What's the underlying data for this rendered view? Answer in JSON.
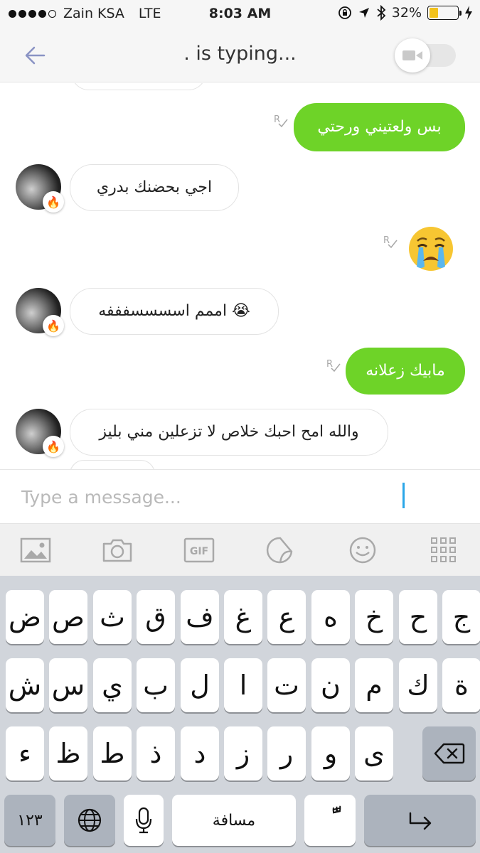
{
  "status_bar": {
    "carrier": "Zain KSA",
    "network": "LTE",
    "time": "8:03 AM",
    "battery": "32%",
    "battery_level": 0.32
  },
  "header": {
    "title": ". is typing..."
  },
  "messages": [
    {
      "direction": "out",
      "text": "بس ولعتيني ورحتي"
    },
    {
      "direction": "in",
      "text": "اجي بحضنك بدري"
    },
    {
      "direction": "out",
      "emoji": "crying-face"
    },
    {
      "direction": "in",
      "text": "اممم اسسسسفففه 😭"
    },
    {
      "direction": "out",
      "text": "مابيك زعلانه"
    },
    {
      "direction": "in",
      "text": "والله امح احبك خلاص لا تزعلين مني بليز"
    }
  ],
  "read_receipt_label": "R",
  "input": {
    "placeholder": "Type a message..."
  },
  "toolbar": [
    "gallery",
    "camera",
    "GIF",
    "sticker",
    "smiley",
    "more"
  ],
  "keyboard": {
    "row1": [
      "ج",
      "ح",
      "خ",
      "ه",
      "ع",
      "غ",
      "ف",
      "ق",
      "ث",
      "ص",
      "ض"
    ],
    "row2": [
      "ة",
      "ك",
      "م",
      "ن",
      "ت",
      "ا",
      "ل",
      "ب",
      "ي",
      "س",
      "ش"
    ],
    "row3": [
      "ى",
      "و",
      "ر",
      "ز",
      "د",
      "ذ",
      "ط",
      "ظ",
      "ء"
    ],
    "numbers_key": "١٢٣",
    "space_key": "مسافة",
    "diacritic_key": "ًّ"
  },
  "colors": {
    "outgoing_bubble": "#6ed328",
    "cursor": "#2aa6e8",
    "keyboard_bg": "#d1d5db"
  }
}
